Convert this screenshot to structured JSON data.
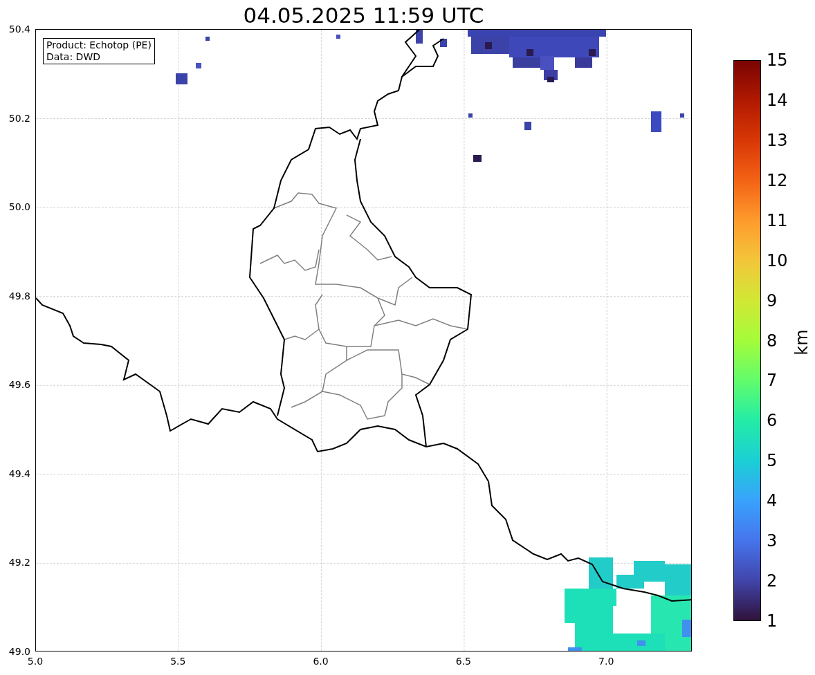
{
  "title": "04.05.2025 11:59 UTC",
  "info_box": [
    "Product: Echotop (PE)",
    "Data: DWD"
  ],
  "x_ticks": [
    "5.0",
    "5.5",
    "6.0",
    "6.5",
    "7.0"
  ],
  "y_ticks": [
    "50.4",
    "50.2",
    "50.0",
    "49.8",
    "49.6",
    "49.4",
    "49.2",
    "49.0"
  ],
  "colorbar": {
    "label": "km",
    "ticks": [
      "15",
      "14",
      "13",
      "12",
      "11",
      "10",
      "9",
      "8",
      "7",
      "6",
      "5",
      "4",
      "3",
      "2",
      "1"
    ]
  }
}
